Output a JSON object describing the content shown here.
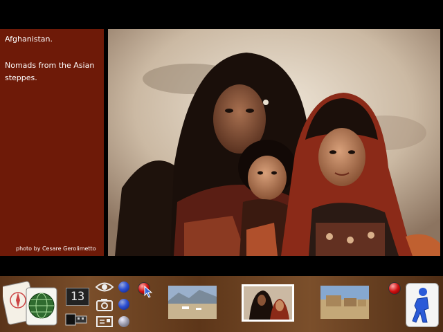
{
  "caption": {
    "title": "Afghanistan.",
    "body": "Nomads from the Asian steppes.",
    "credit": "photo by Cesare Gerolimetto"
  },
  "toolbar": {
    "counter_value": "13",
    "thumbnails": [
      {
        "name": "mountain-plain-thumbnail",
        "selected": false
      },
      {
        "name": "nomads-thumbnail",
        "selected": true
      },
      {
        "name": "village-thumbnail",
        "selected": false
      }
    ]
  },
  "colors": {
    "caption_bg": "#6e1a08",
    "toolbar_bg": "#5d3619",
    "accent_blue": "#2c4fd4",
    "accent_red": "#d01010"
  }
}
